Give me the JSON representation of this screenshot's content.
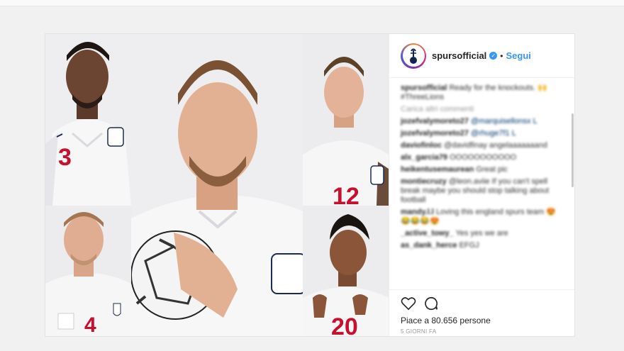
{
  "post": {
    "username": "spursofficial",
    "dot": "•",
    "follow_label": "Segui",
    "verified_glyph": "✓",
    "caption": {
      "user": "spursofficial",
      "text": "Ready for the knockouts. 🙌 #ThreeLions"
    },
    "load_more": "Carica altri commenti",
    "comments": [
      {
        "user": "jozefvalymoreto27",
        "text": "@marquisellonsx L"
      },
      {
        "user": "jozefvalymoreto27",
        "text": "@rhuge7f1 L"
      },
      {
        "user": "daviofinloc",
        "text": "@davidfinay angelaaaaaaand"
      },
      {
        "user": "alx_garcia79",
        "text": "OOOOOOOOOOO"
      },
      {
        "user": "heikentusemaurean",
        "text": "Great pic"
      },
      {
        "user": "montiecruzy",
        "text": "@leon.aviie If you can't spell break maybe you should stop talking about football"
      },
      {
        "user": "mandy.l.l",
        "text": "Loving this england spurs team 😍😂😂😂😍"
      },
      {
        "user": "_active_towy_",
        "text": "Yes yes we are"
      },
      {
        "user": "as_dank_herce",
        "text": "EFGJ"
      }
    ],
    "likes_label": "Piace a 80.656 persone",
    "time_label": "5 GIORNI FA",
    "jersey_numbers": [
      "3",
      "12",
      "4",
      "20"
    ],
    "colors": {
      "accent": "#3897f0",
      "shirt": "#f7f7f8",
      "number_red": "#c8102e",
      "navy": "#1d2b53"
    }
  }
}
